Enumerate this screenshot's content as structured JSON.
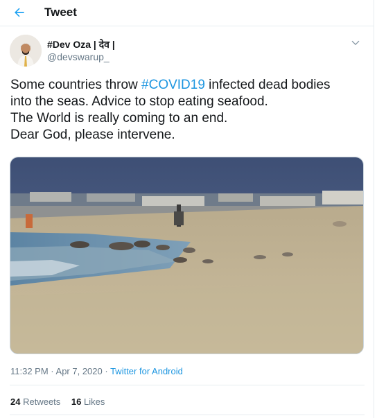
{
  "header": {
    "title": "Tweet",
    "back_icon": "arrow-left-icon"
  },
  "author": {
    "display_name": "#Dev Oza | देव |",
    "handle": "@devswarup_"
  },
  "tweet": {
    "text_parts": {
      "line1_prefix": "Some countries throw ",
      "hashtag": "#COVID19",
      "line1_suffix": " infected dead bodies",
      "line2": "into the seas. Advice to stop eating seafood.",
      "line3": "The World is really coming to an end.",
      "line4": "Dear God, please intervene."
    }
  },
  "meta": {
    "time": "11:32 PM",
    "separator": " · ",
    "date": "Apr 7, 2020",
    "source": "Twitter for Android"
  },
  "stats": {
    "retweets_count": "24",
    "retweets_label": "Retweets",
    "likes_count": "16",
    "likes_label": "Likes"
  },
  "colors": {
    "link": "#1b95e0",
    "secondary": "#657786",
    "border": "#e6ecf0"
  }
}
